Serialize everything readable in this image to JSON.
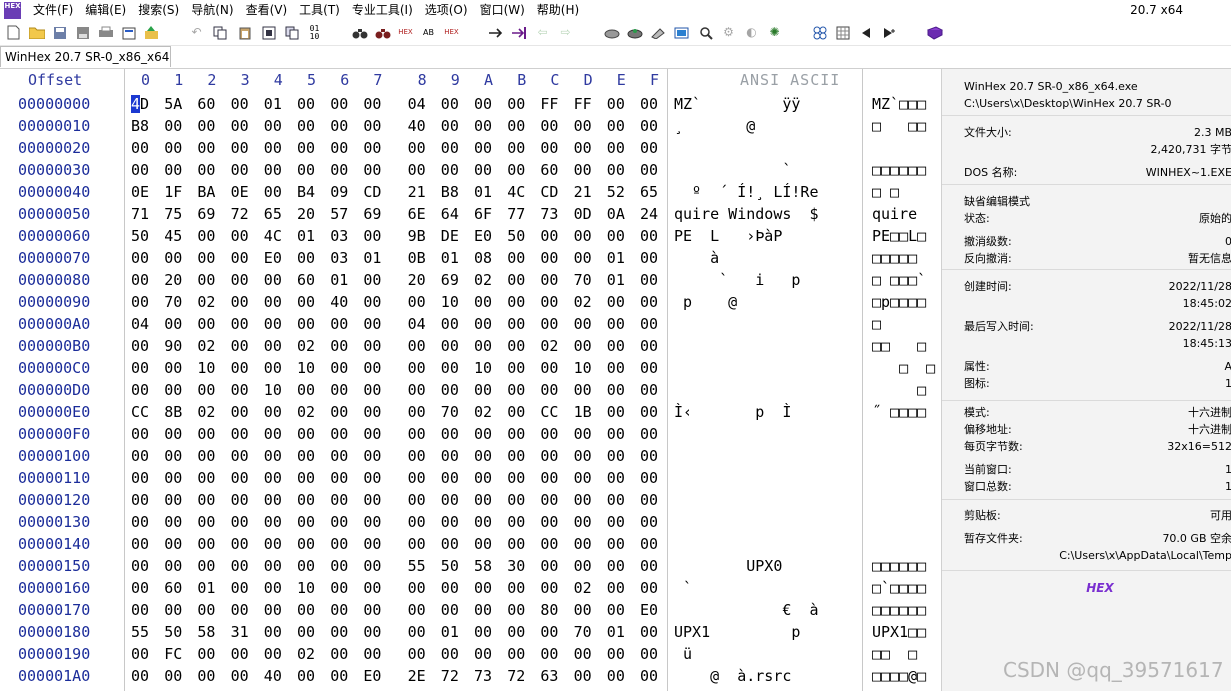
{
  "menubar": {
    "app_icon_text": "HEX",
    "items": [
      "文件(F)",
      "编辑(E)",
      "搜索(S)",
      "导航(N)",
      "查看(V)",
      "工具(T)",
      "专业工具(I)",
      "选项(O)",
      "窗口(W)",
      "帮助(H)"
    ],
    "version": "20.7 x64"
  },
  "toolbar": {
    "icons": [
      "new-file-icon",
      "open-folder-icon",
      "save-icon",
      "save-all-icon",
      "print-icon",
      "properties-icon",
      "open-disk-icon",
      "undo-icon",
      "copy-icon",
      "paste-icon",
      "clipboard-icon",
      "copy-block-icon",
      "binary-icon",
      "find-icon",
      "find-hex-icon",
      "replace-hex-icon",
      "find-text-icon",
      "find-hex-value-icon",
      "goto-offset-icon",
      "goto-sector-icon",
      "back-icon",
      "forward-icon",
      "disk-editor-icon",
      "ram-editor-icon",
      "calculator-icon",
      "zoom-icon",
      "search-disk-icon",
      "settings-icon",
      "analysis-icon",
      "template-icon",
      "previous-icon",
      "next-icon",
      "help-book-icon"
    ]
  },
  "tab": {
    "label": "WinHex 20.7 SR-0_x86_x64..."
  },
  "editor": {
    "offset_header": "Offset",
    "hex_headers": [
      "0",
      "1",
      "2",
      "3",
      "4",
      "5",
      "6",
      "7",
      "8",
      "9",
      "A",
      "B",
      "C",
      "D",
      "E",
      "F"
    ],
    "ansi_header": "ANSI ASCII",
    "rows": [
      {
        "offset": "00000000",
        "bytes": [
          "4D",
          "5A",
          "60",
          "00",
          "01",
          "00",
          "00",
          "00",
          "04",
          "00",
          "00",
          "00",
          "FF",
          "FF",
          "00",
          "00"
        ],
        "ansi": "MZ`         ÿÿ",
        "ascii": "MZ`□□□"
      },
      {
        "offset": "00000010",
        "bytes": [
          "B8",
          "00",
          "00",
          "00",
          "00",
          "00",
          "00",
          "00",
          "40",
          "00",
          "00",
          "00",
          "00",
          "00",
          "00",
          "00"
        ],
        "ansi": "¸       @",
        "ascii": "□   □□"
      },
      {
        "offset": "00000020",
        "bytes": [
          "00",
          "00",
          "00",
          "00",
          "00",
          "00",
          "00",
          "00",
          "00",
          "00",
          "00",
          "00",
          "00",
          "00",
          "00",
          "00"
        ],
        "ansi": "",
        "ascii": ""
      },
      {
        "offset": "00000030",
        "bytes": [
          "00",
          "00",
          "00",
          "00",
          "00",
          "00",
          "00",
          "00",
          "00",
          "00",
          "00",
          "00",
          "60",
          "00",
          "00",
          "00"
        ],
        "ansi": "            `",
        "ascii": "□□□□□□"
      },
      {
        "offset": "00000040",
        "bytes": [
          "0E",
          "1F",
          "BA",
          "0E",
          "00",
          "B4",
          "09",
          "CD",
          "21",
          "B8",
          "01",
          "4C",
          "CD",
          "21",
          "52",
          "65"
        ],
        "ansi": "  º  ´ Í!¸ LÍ!Re",
        "ascii": "□ □"
      },
      {
        "offset": "00000050",
        "bytes": [
          "71",
          "75",
          "69",
          "72",
          "65",
          "20",
          "57",
          "69",
          "6E",
          "64",
          "6F",
          "77",
          "73",
          "0D",
          "0A",
          "24"
        ],
        "ansi": "quire Windows  $",
        "ascii": "quire"
      },
      {
        "offset": "00000060",
        "bytes": [
          "50",
          "45",
          "00",
          "00",
          "4C",
          "01",
          "03",
          "00",
          "9B",
          "DE",
          "E0",
          "50",
          "00",
          "00",
          "00",
          "00"
        ],
        "ansi": "PE  L   ›ÞàP",
        "ascii": "PE□□L□"
      },
      {
        "offset": "00000070",
        "bytes": [
          "00",
          "00",
          "00",
          "00",
          "E0",
          "00",
          "03",
          "01",
          "0B",
          "01",
          "08",
          "00",
          "00",
          "00",
          "01",
          "00"
        ],
        "ansi": "    à",
        "ascii": "□□□□□"
      },
      {
        "offset": "00000080",
        "bytes": [
          "00",
          "20",
          "00",
          "00",
          "00",
          "60",
          "01",
          "00",
          "20",
          "69",
          "02",
          "00",
          "00",
          "70",
          "01",
          "00"
        ],
        "ansi": "     `   i   p",
        "ascii": "□ □□□`"
      },
      {
        "offset": "00000090",
        "bytes": [
          "00",
          "70",
          "02",
          "00",
          "00",
          "00",
          "40",
          "00",
          "00",
          "10",
          "00",
          "00",
          "00",
          "02",
          "00",
          "00"
        ],
        "ansi": " p    @",
        "ascii": "□p□□□□"
      },
      {
        "offset": "000000A0",
        "bytes": [
          "04",
          "00",
          "00",
          "00",
          "00",
          "00",
          "00",
          "00",
          "04",
          "00",
          "00",
          "00",
          "00",
          "00",
          "00",
          "00"
        ],
        "ansi": "",
        "ascii": "□"
      },
      {
        "offset": "000000B0",
        "bytes": [
          "00",
          "90",
          "02",
          "00",
          "00",
          "02",
          "00",
          "00",
          "00",
          "00",
          "00",
          "00",
          "02",
          "00",
          "00",
          "00"
        ],
        "ansi": "",
        "ascii": "□□   □"
      },
      {
        "offset": "000000C0",
        "bytes": [
          "00",
          "00",
          "10",
          "00",
          "00",
          "10",
          "00",
          "00",
          "00",
          "00",
          "10",
          "00",
          "00",
          "10",
          "00",
          "00"
        ],
        "ansi": "",
        "ascii": "   □  □"
      },
      {
        "offset": "000000D0",
        "bytes": [
          "00",
          "00",
          "00",
          "00",
          "10",
          "00",
          "00",
          "00",
          "00",
          "00",
          "00",
          "00",
          "00",
          "00",
          "00",
          "00"
        ],
        "ansi": "",
        "ascii": "     □"
      },
      {
        "offset": "000000E0",
        "bytes": [
          "CC",
          "8B",
          "02",
          "00",
          "00",
          "02",
          "00",
          "00",
          "00",
          "70",
          "02",
          "00",
          "CC",
          "1B",
          "00",
          "00"
        ],
        "ansi": "Ì‹       p  Ì",
        "ascii": "˝ □□□□"
      },
      {
        "offset": "000000F0",
        "bytes": [
          "00",
          "00",
          "00",
          "00",
          "00",
          "00",
          "00",
          "00",
          "00",
          "00",
          "00",
          "00",
          "00",
          "00",
          "00",
          "00"
        ],
        "ansi": "",
        "ascii": ""
      },
      {
        "offset": "00000100",
        "bytes": [
          "00",
          "00",
          "00",
          "00",
          "00",
          "00",
          "00",
          "00",
          "00",
          "00",
          "00",
          "00",
          "00",
          "00",
          "00",
          "00"
        ],
        "ansi": "",
        "ascii": ""
      },
      {
        "offset": "00000110",
        "bytes": [
          "00",
          "00",
          "00",
          "00",
          "00",
          "00",
          "00",
          "00",
          "00",
          "00",
          "00",
          "00",
          "00",
          "00",
          "00",
          "00"
        ],
        "ansi": "",
        "ascii": ""
      },
      {
        "offset": "00000120",
        "bytes": [
          "00",
          "00",
          "00",
          "00",
          "00",
          "00",
          "00",
          "00",
          "00",
          "00",
          "00",
          "00",
          "00",
          "00",
          "00",
          "00"
        ],
        "ansi": "",
        "ascii": ""
      },
      {
        "offset": "00000130",
        "bytes": [
          "00",
          "00",
          "00",
          "00",
          "00",
          "00",
          "00",
          "00",
          "00",
          "00",
          "00",
          "00",
          "00",
          "00",
          "00",
          "00"
        ],
        "ansi": "",
        "ascii": ""
      },
      {
        "offset": "00000140",
        "bytes": [
          "00",
          "00",
          "00",
          "00",
          "00",
          "00",
          "00",
          "00",
          "00",
          "00",
          "00",
          "00",
          "00",
          "00",
          "00",
          "00"
        ],
        "ansi": "",
        "ascii": ""
      },
      {
        "offset": "00000150",
        "bytes": [
          "00",
          "00",
          "00",
          "00",
          "00",
          "00",
          "00",
          "00",
          "55",
          "50",
          "58",
          "30",
          "00",
          "00",
          "00",
          "00"
        ],
        "ansi": "        UPX0",
        "ascii": "□□□□□□"
      },
      {
        "offset": "00000160",
        "bytes": [
          "00",
          "60",
          "01",
          "00",
          "00",
          "10",
          "00",
          "00",
          "00",
          "00",
          "00",
          "00",
          "00",
          "02",
          "00",
          "00"
        ],
        "ansi": " `",
        "ascii": "□`□□□□"
      },
      {
        "offset": "00000170",
        "bytes": [
          "00",
          "00",
          "00",
          "00",
          "00",
          "00",
          "00",
          "00",
          "00",
          "00",
          "00",
          "00",
          "80",
          "00",
          "00",
          "E0"
        ],
        "ansi": "            €  à",
        "ascii": "□□□□□□"
      },
      {
        "offset": "00000180",
        "bytes": [
          "55",
          "50",
          "58",
          "31",
          "00",
          "00",
          "00",
          "00",
          "00",
          "01",
          "00",
          "00",
          "00",
          "70",
          "01",
          "00"
        ],
        "ansi": "UPX1         p",
        "ascii": "UPX1□□"
      },
      {
        "offset": "00000190",
        "bytes": [
          "00",
          "FC",
          "00",
          "00",
          "00",
          "02",
          "00",
          "00",
          "00",
          "00",
          "00",
          "00",
          "00",
          "00",
          "00",
          "00"
        ],
        "ansi": " ü",
        "ascii": "□□  □"
      },
      {
        "offset": "000001A0",
        "bytes": [
          "00",
          "00",
          "00",
          "00",
          "40",
          "00",
          "00",
          "E0",
          "2E",
          "72",
          "73",
          "72",
          "63",
          "00",
          "00",
          "00"
        ],
        "ansi": "    @  à.rsrc",
        "ascii": "□□□□@□"
      }
    ]
  },
  "info_panel": {
    "filename": "WinHex 20.7 SR-0_x86_x64.exe",
    "path": "C:\\Users\\x\\Desktop\\WinHex 20.7 SR-0",
    "file_size_label": "文件大小:",
    "file_size_1": "2.3 MB",
    "file_size_2": "2,420,731 字节",
    "dos_name_label": "DOS 名称:",
    "dos_name": "WINHEX~1.EXE",
    "edit_mode_label": "缺省编辑模式",
    "state_label": "状态:",
    "state_value": "原始的",
    "undo_level_label": "撤消级数:",
    "undo_level_value": "0",
    "reverse_undo_label": "反向撤消:",
    "reverse_undo_value": "暂无信息",
    "created_label": "创建时间:",
    "created_date": "2022/11/28",
    "created_time": "18:45:02",
    "modified_label": "最后写入时间:",
    "modified_date": "2022/11/28",
    "modified_time": "18:45:13",
    "attr_label": "属性:",
    "attr_value": "A",
    "icon_label": "图标:",
    "icon_value": "1",
    "mode_label": "模式:",
    "mode_value": "十六进制",
    "offset_addr_label": "偏移地址:",
    "offset_addr_value": "十六进制",
    "bytes_per_page_label": "每页字节数:",
    "bytes_per_page_value": "32x16=512",
    "current_window_label": "当前窗口:",
    "current_window_value": "1",
    "total_windows_label": "窗口总数:",
    "total_windows_value": "1",
    "clipboard_label": "剪贴板:",
    "clipboard_value": "可用",
    "temp_label": "暂存文件夹:",
    "temp_value_1": "70.0 GB 空余",
    "temp_value_2": "C:\\Users\\x\\AppData\\Local\\Temp",
    "logo_text": "HEX"
  },
  "watermark": "CSDN @qq_39571617"
}
